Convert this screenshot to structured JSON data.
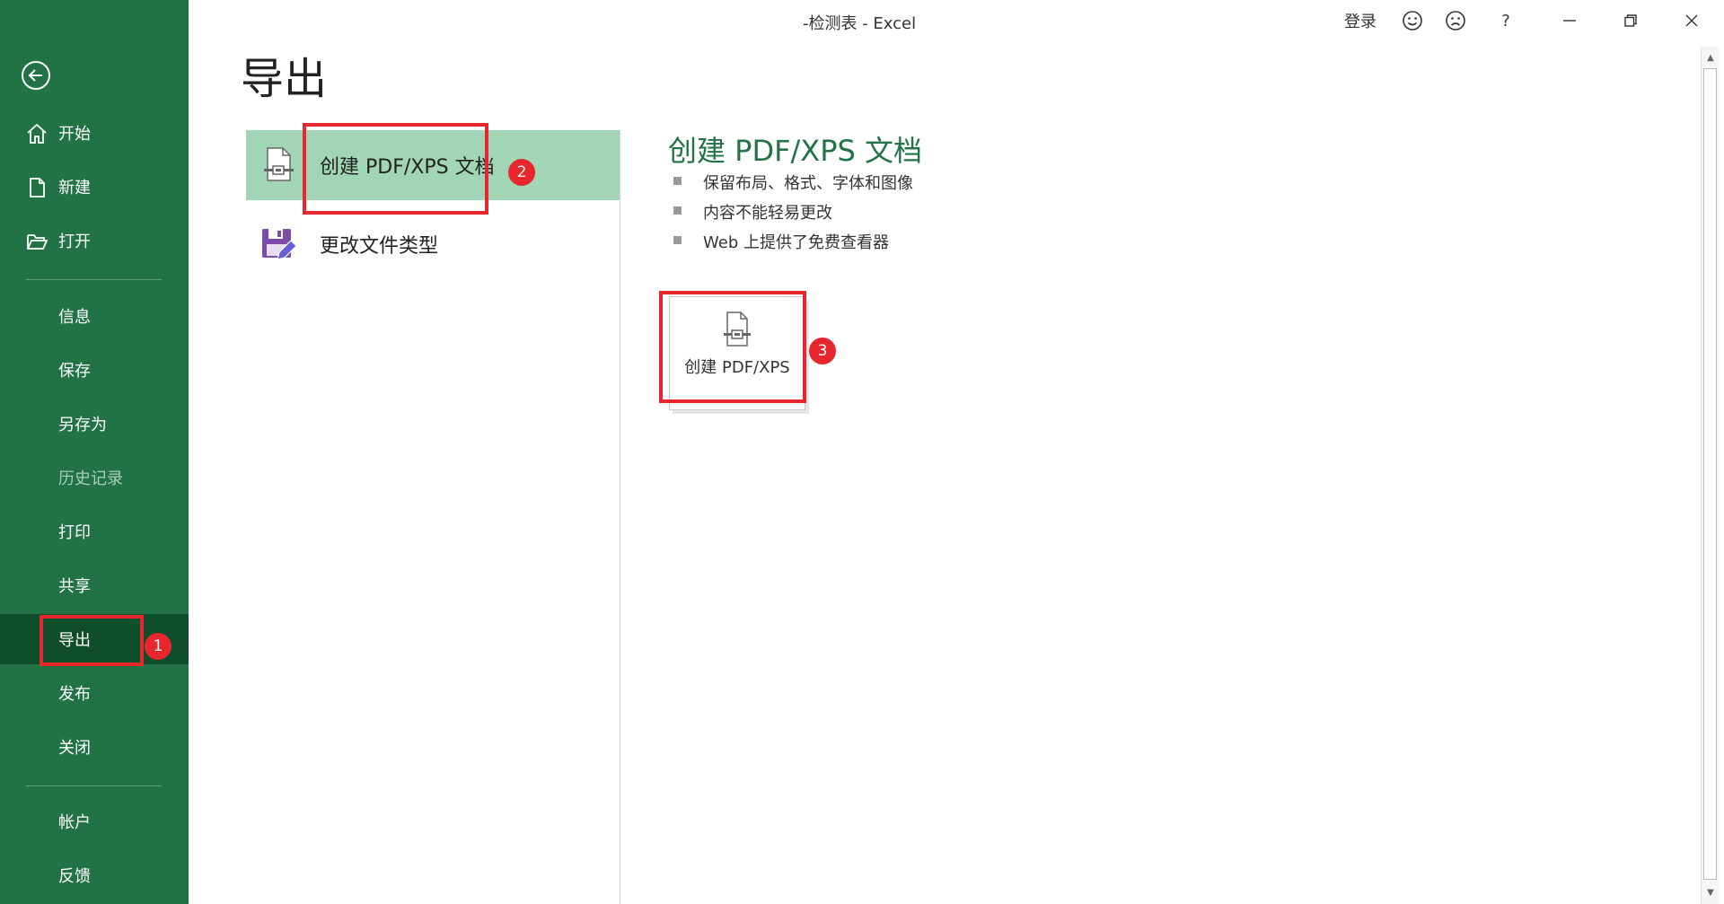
{
  "window": {
    "title": "-检测表  -  Excel"
  },
  "title_bar": {
    "sign_in": "登录",
    "help": "?",
    "smile_icon": "smile-icon",
    "frown_icon": "frown-icon"
  },
  "sidebar": {
    "items": [
      {
        "label": "开始",
        "icon": "home-icon"
      },
      {
        "label": "新建",
        "icon": "new-document-icon"
      },
      {
        "label": "打开",
        "icon": "open-folder-icon"
      },
      {
        "label": "信息"
      },
      {
        "label": "保存"
      },
      {
        "label": "另存为"
      },
      {
        "label": "历史记录",
        "disabled": true
      },
      {
        "label": "打印"
      },
      {
        "label": "共享"
      },
      {
        "label": "导出",
        "active": true
      },
      {
        "label": "发布"
      },
      {
        "label": "关闭"
      },
      {
        "label": "帐户"
      },
      {
        "label": "反馈"
      }
    ]
  },
  "page": {
    "title": "导出"
  },
  "export_options": [
    {
      "label": "创建 PDF/XPS 文档",
      "icon": "pdf-document-icon",
      "selected": true
    },
    {
      "label": "更改文件类型",
      "icon": "save-as-type-icon",
      "selected": false
    }
  ],
  "detail": {
    "heading": "创建 PDF/XPS 文档",
    "bullets": [
      "保留布局、格式、字体和图像",
      "内容不能轻易更改",
      "Web 上提供了免费查看器"
    ],
    "create_button_label": "创建 PDF/XPS"
  },
  "annotations": {
    "marker1": "1",
    "marker2": "2",
    "marker3": "3"
  },
  "colors": {
    "accent": "#217346",
    "selected": "#a1d5b5",
    "active_nav": "#0e4e2a",
    "highlight": "#e8262d"
  }
}
